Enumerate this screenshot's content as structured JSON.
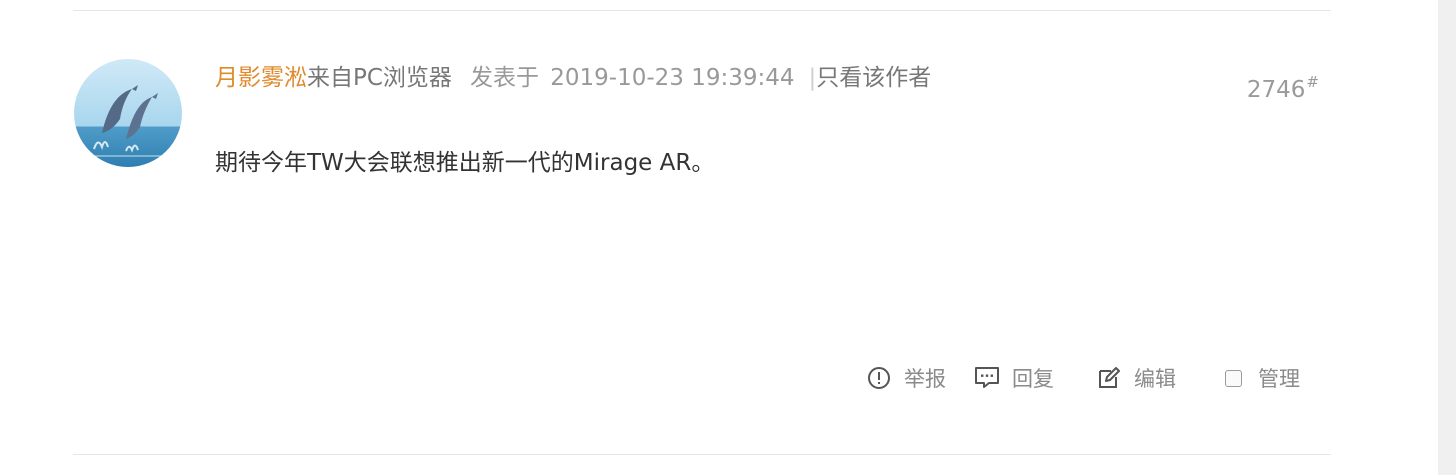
{
  "post": {
    "author": "月影雾淞",
    "source": "来自PC浏览器",
    "posted_label": "发表于",
    "posted_time": "2019-10-23 19:39:44",
    "separator": "|",
    "only_author": "只看该作者",
    "floor_number": "2746",
    "floor_mark": "#",
    "content": "期待今年TW大会联想推出新一代的Mirage AR。"
  },
  "actions": {
    "report": "举报",
    "reply": "回复",
    "edit": "编辑",
    "manage": "管理"
  },
  "icons": {
    "report": "alert-circle-icon",
    "reply": "speech-bubble-icon",
    "edit": "edit-pencil-icon",
    "manage": "checkbox-icon"
  },
  "colors": {
    "author": "#e08a2c",
    "meta": "#999999",
    "content": "#333333"
  }
}
